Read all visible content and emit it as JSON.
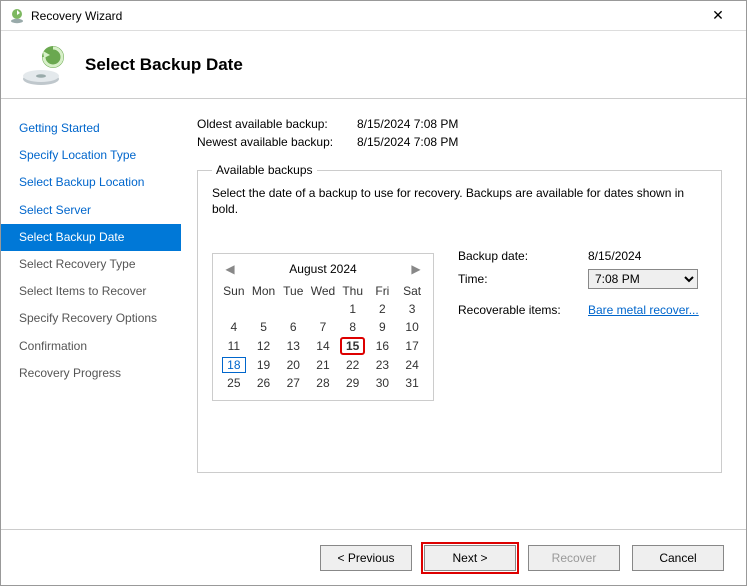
{
  "window": {
    "title": "Recovery Wizard"
  },
  "header": {
    "title": "Select Backup Date"
  },
  "sidebar": {
    "steps": [
      {
        "label": "Getting Started",
        "state": "done"
      },
      {
        "label": "Specify Location Type",
        "state": "done"
      },
      {
        "label": "Select Backup Location",
        "state": "done"
      },
      {
        "label": "Select Server",
        "state": "done"
      },
      {
        "label": "Select Backup Date",
        "state": "active"
      },
      {
        "label": "Select Recovery Type",
        "state": "future"
      },
      {
        "label": "Select Items to Recover",
        "state": "future"
      },
      {
        "label": "Specify Recovery Options",
        "state": "future"
      },
      {
        "label": "Confirmation",
        "state": "future"
      },
      {
        "label": "Recovery Progress",
        "state": "future"
      }
    ]
  },
  "info": {
    "oldest_label": "Oldest available backup:",
    "oldest_value": "8/15/2024 7:08 PM",
    "newest_label": "Newest available backup:",
    "newest_value": "8/15/2024 7:08 PM"
  },
  "available": {
    "legend": "Available backups",
    "instruction": "Select the date of a backup to use for recovery. Backups are available for dates shown in bold."
  },
  "calendar": {
    "month_label": "August 2024",
    "dow": [
      "Sun",
      "Mon",
      "Tue",
      "Wed",
      "Thu",
      "Fri",
      "Sat"
    ],
    "weeks": [
      [
        "",
        "",
        "",
        "",
        "1",
        "2",
        "3"
      ],
      [
        "4",
        "5",
        "6",
        "7",
        "8",
        "9",
        "10"
      ],
      [
        "11",
        "12",
        "13",
        "14",
        "15",
        "16",
        "17"
      ],
      [
        "18",
        "19",
        "20",
        "21",
        "22",
        "23",
        "24"
      ],
      [
        "25",
        "26",
        "27",
        "28",
        "29",
        "30",
        "31"
      ]
    ],
    "selected": "15",
    "today": "18"
  },
  "details": {
    "backup_date_label": "Backup date:",
    "backup_date_value": "8/15/2024",
    "time_label": "Time:",
    "time_value": "7:08 PM",
    "recoverable_label": "Recoverable items:",
    "recoverable_link": "Bare metal recover..."
  },
  "footer": {
    "previous": "< Previous",
    "next": "Next >",
    "recover": "Recover",
    "cancel": "Cancel"
  }
}
